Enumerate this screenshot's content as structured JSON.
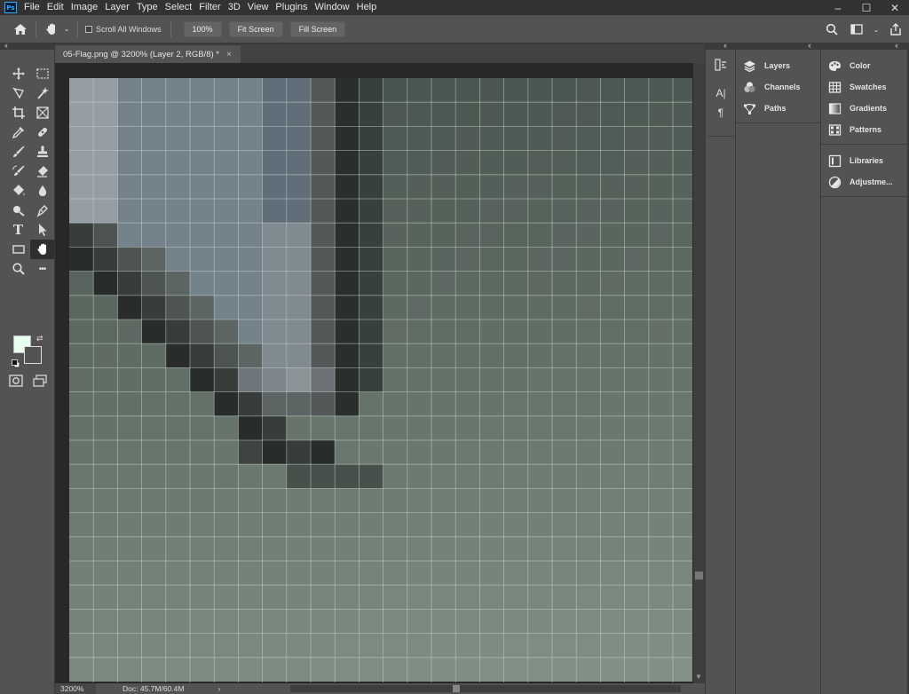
{
  "app": {
    "logo": "Ps"
  },
  "menu": [
    "File",
    "Edit",
    "Image",
    "Layer",
    "Type",
    "Select",
    "Filter",
    "3D",
    "View",
    "Plugins",
    "Window",
    "Help"
  ],
  "window_controls": {
    "minimize": "–",
    "maximize": "☐",
    "close": "✕"
  },
  "options_bar": {
    "scroll_all_windows": "Scroll All Windows",
    "zoom_100": "100%",
    "fit_screen": "Fit Screen",
    "fill_screen": "Fill Screen"
  },
  "document": {
    "tab_title": "05-Flag.png @ 3200% (Layer 2, RGB/8) *",
    "tab_close": "×"
  },
  "status": {
    "zoom": "3200%",
    "doc": "Doc: 45.7M/60.4M",
    "chevron": "›"
  },
  "colors": {
    "foreground": "#e6ffee",
    "background": "#535353",
    "ui_dark": "#323232",
    "ui_mid": "#535353"
  },
  "tools": [
    "move-tool",
    "marquee-tool",
    "lasso-tool",
    "magic-wand-tool",
    "crop-tool",
    "frame-tool",
    "eyedropper-tool",
    "healing-tool",
    "brush-tool",
    "stamp-tool",
    "history-brush-tool",
    "eraser-tool",
    "bucket-tool",
    "blur-tool",
    "dodge-tool",
    "pen-tool",
    "type-tool",
    "path-select-tool",
    "shape-tool",
    "hand-tool",
    "zoom-tool",
    "more-tools"
  ],
  "type_tool_label": "T",
  "more_tools_label": "•••",
  "panels": {
    "column1": [
      {
        "label": "Layers",
        "icon": "layers-icon"
      },
      {
        "label": "Channels",
        "icon": "channels-icon"
      },
      {
        "label": "Paths",
        "icon": "paths-icon"
      }
    ],
    "column2_group1": [
      {
        "label": "Color",
        "icon": "color-icon"
      },
      {
        "label": "Swatches",
        "icon": "swatches-icon"
      },
      {
        "label": "Gradients",
        "icon": "gradients-icon"
      },
      {
        "label": "Patterns",
        "icon": "patterns-icon"
      }
    ],
    "column2_group2": [
      {
        "label": "Libraries",
        "icon": "libraries-icon"
      },
      {
        "label": "Adjustme...",
        "icon": "adjustments-icon"
      }
    ]
  },
  "icon_column": {
    "character_label": "A|",
    "paragraph_label": "¶"
  }
}
